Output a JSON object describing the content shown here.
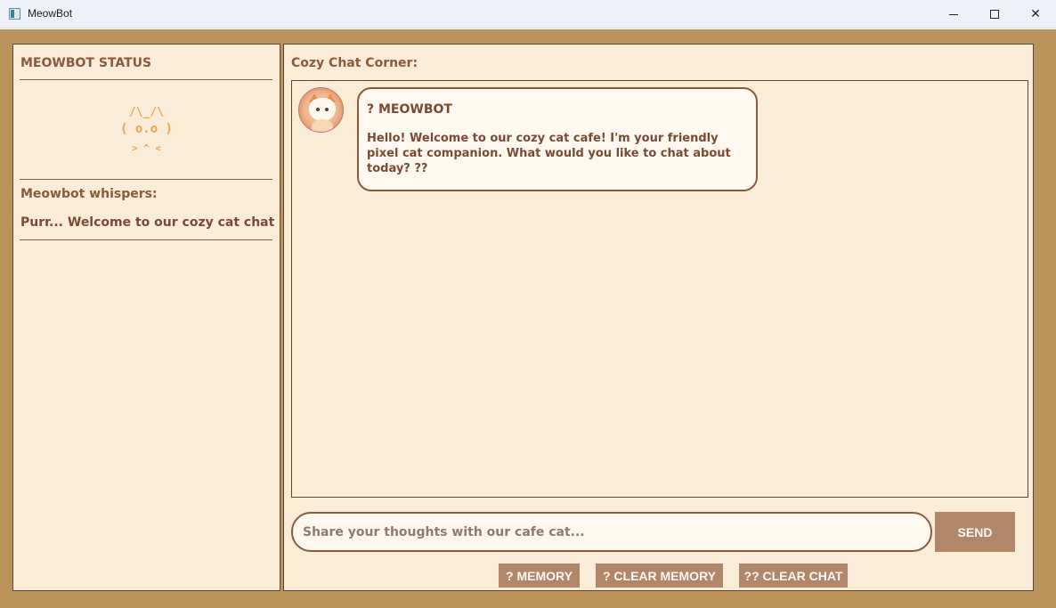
{
  "window": {
    "title": "MeowBot"
  },
  "left": {
    "status_title": "MEOWBOT STATUS",
    "ascii_line1": "/\\_/\\",
    "ascii_line2": "( o.o )",
    "ascii_line3": "> ^ <",
    "whisper_title": "Meowbot whispers:",
    "whisper_text": "Purr... Welcome to our cozy cat chat"
  },
  "chat": {
    "title": "Cozy Chat Corner:",
    "messages": [
      {
        "sender": "? MEOWBOT",
        "text": "Hello! Welcome to our cozy cat cafe! I'm your friendly pixel cat companion. What would you like to chat about today? ??"
      }
    ]
  },
  "input": {
    "placeholder": "Share your thoughts with our cafe cat..."
  },
  "buttons": {
    "send": "SEND",
    "memory": "? MEMORY",
    "clear_memory": "? CLEAR MEMORY",
    "clear_chat": "?? CLEAR CHAT"
  },
  "colors": {
    "frame": "#b9935a",
    "panel": "#fbecd8",
    "accent_text": "#8a5a3c",
    "button": "#b0876a",
    "ascii_cat": "#f0a253"
  },
  "icons": {
    "app": "app-icon",
    "avatar": "cat-avatar"
  }
}
